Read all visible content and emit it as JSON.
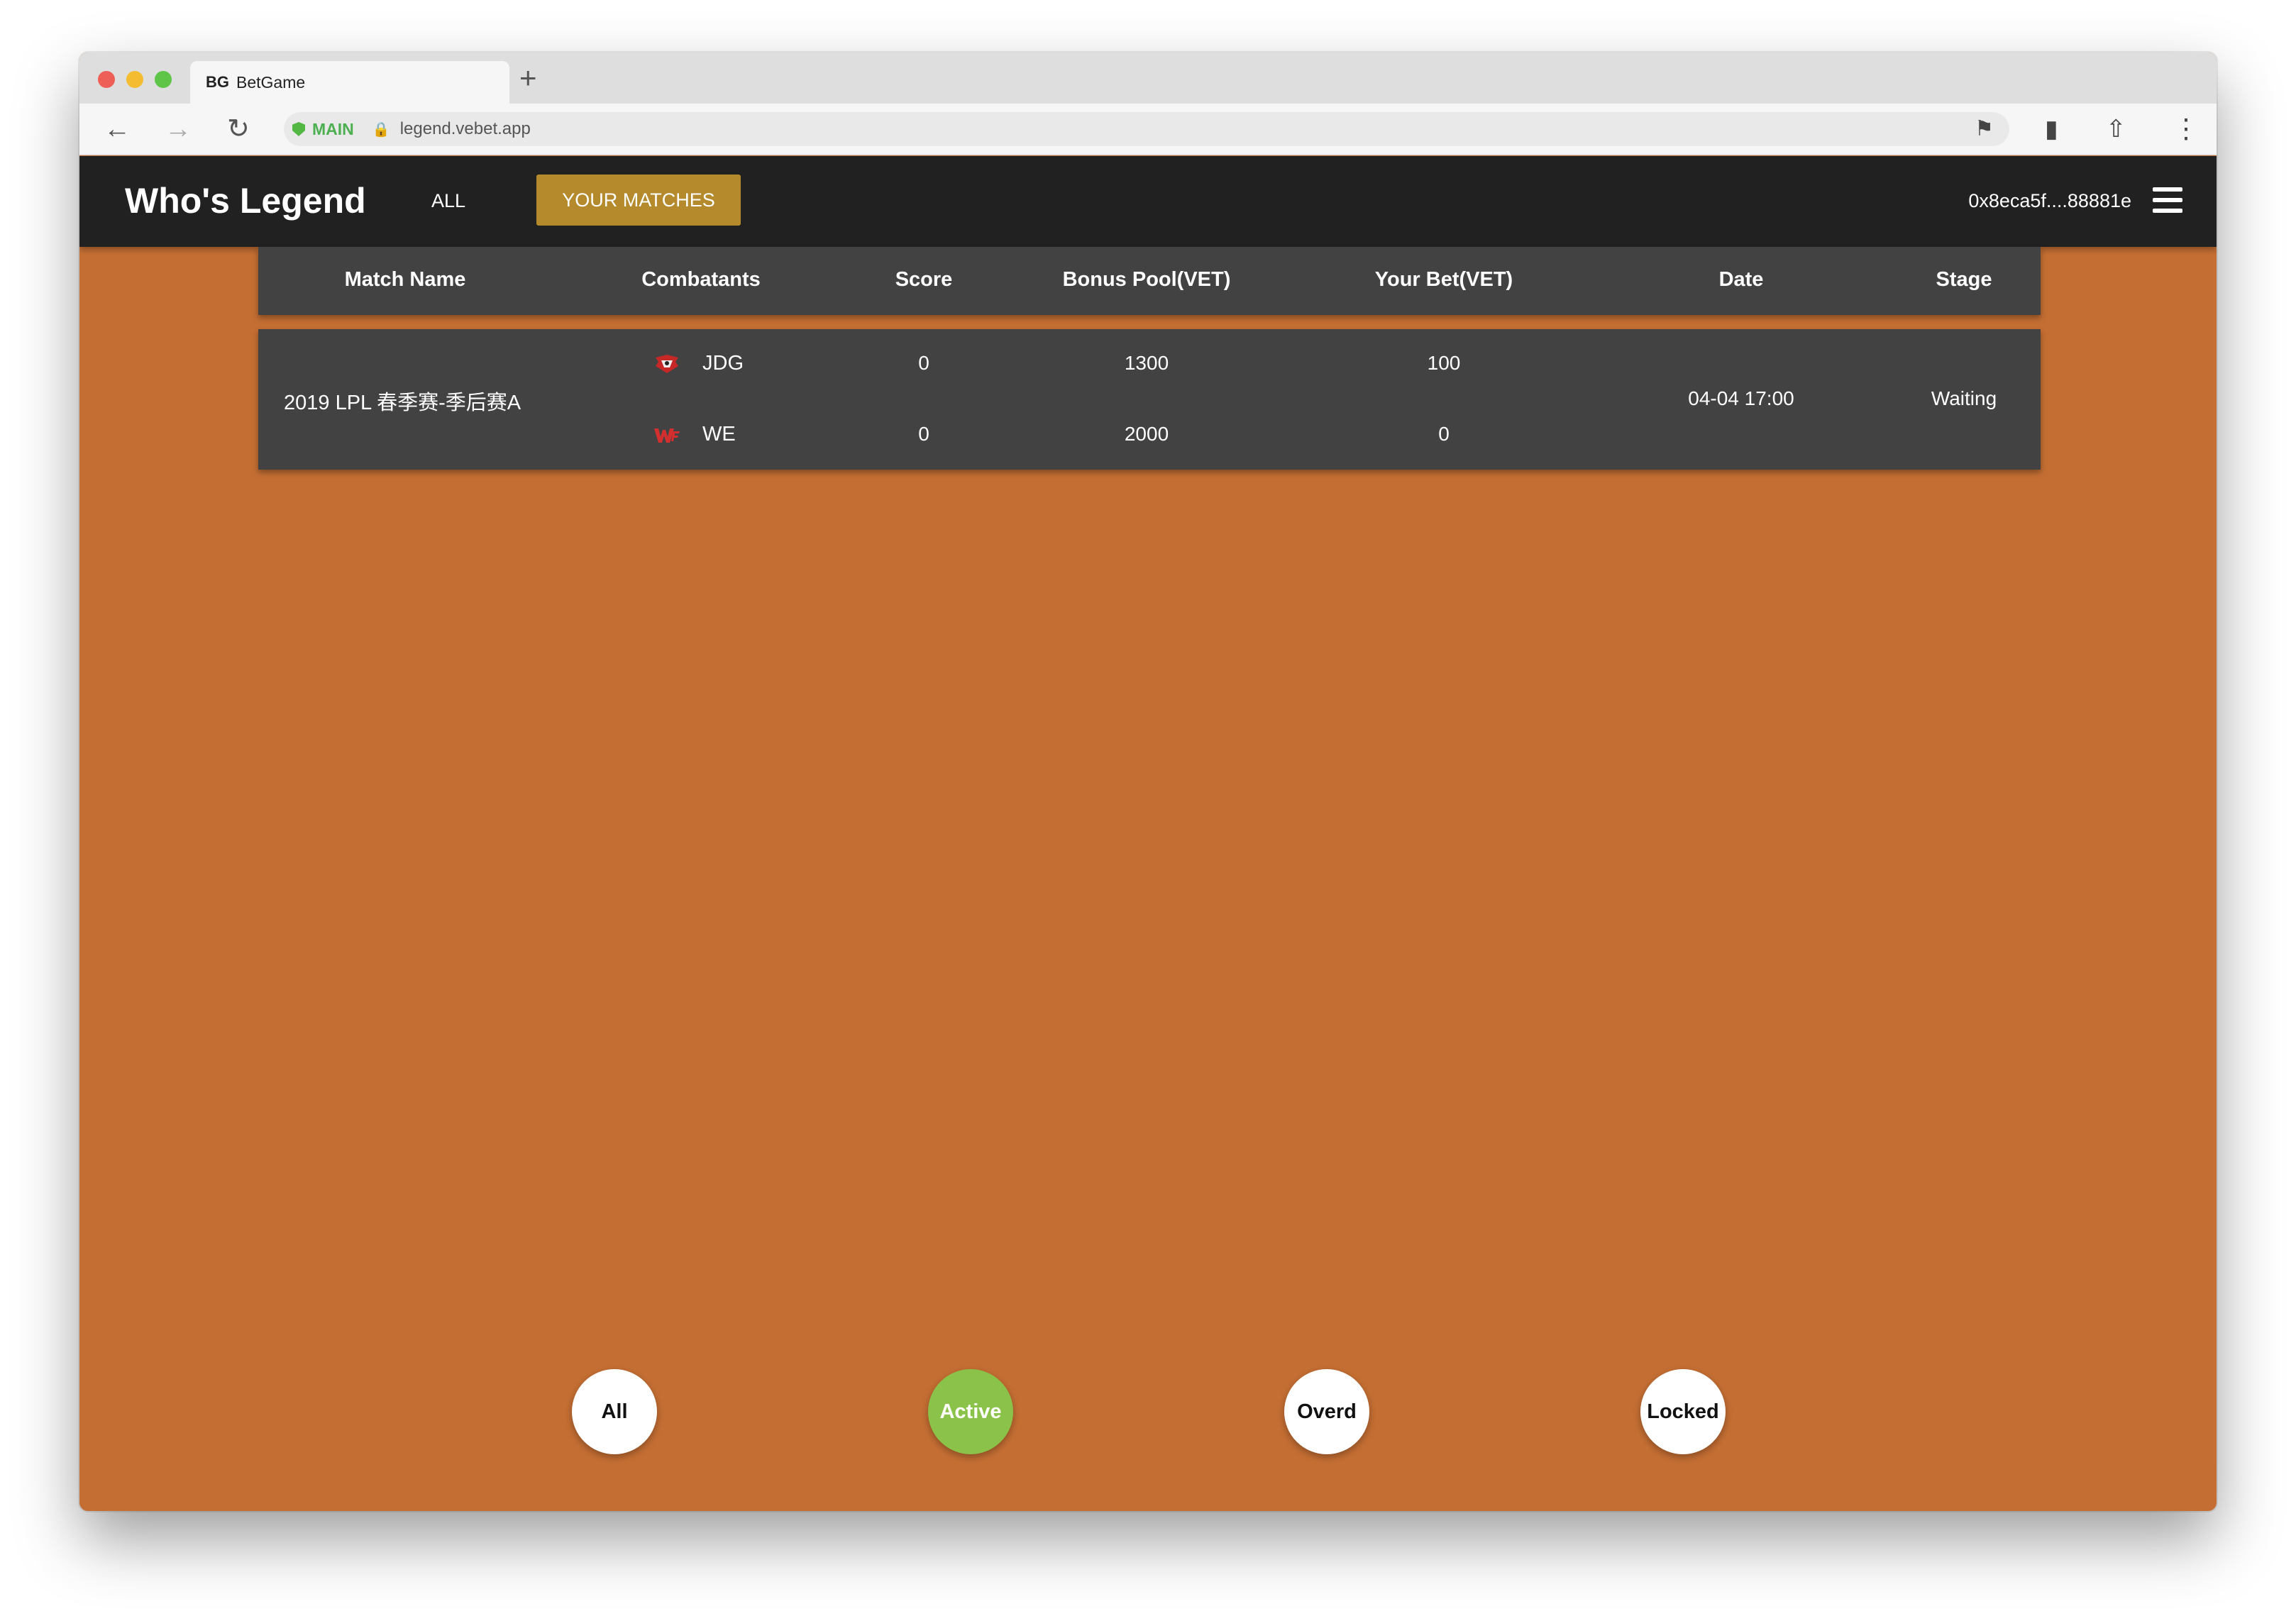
{
  "browser": {
    "tab_favicon": "BG",
    "tab_title": "BetGame",
    "new_tab": "+",
    "network_badge": "MAIN",
    "url": "legend.vebet.app"
  },
  "header": {
    "brand": "Who's Legend",
    "nav": {
      "all": "ALL",
      "your_matches": "YOUR MATCHES"
    },
    "wallet": "0x8eca5f....88881e",
    "accent_color": "#b48a2c"
  },
  "table": {
    "columns": [
      "Match Name",
      "Combatants",
      "Score",
      "Bonus Pool(VET)",
      "Your Bet(VET)",
      "Date",
      "Stage"
    ],
    "rows": [
      {
        "match_name": "2019 LPL 春季赛-季后赛A",
        "teams": [
          {
            "name": "JDG",
            "score": "0",
            "pool": "1300",
            "bet": "100",
            "logo": "jdg-logo-icon"
          },
          {
            "name": "WE",
            "score": "0",
            "pool": "2000",
            "bet": "0",
            "logo": "we-logo-icon"
          }
        ],
        "date": "04-04 17:00",
        "stage": "Waiting"
      }
    ]
  },
  "filters": {
    "items": [
      {
        "label": "All"
      },
      {
        "label": "Active"
      },
      {
        "label": "Overd"
      },
      {
        "label": "Locked"
      }
    ],
    "selected": "Active",
    "active_color": "#8bc34a"
  },
  "colors": {
    "page_background": "#c46e33",
    "appbar": "#212121",
    "panel": "#424242"
  }
}
